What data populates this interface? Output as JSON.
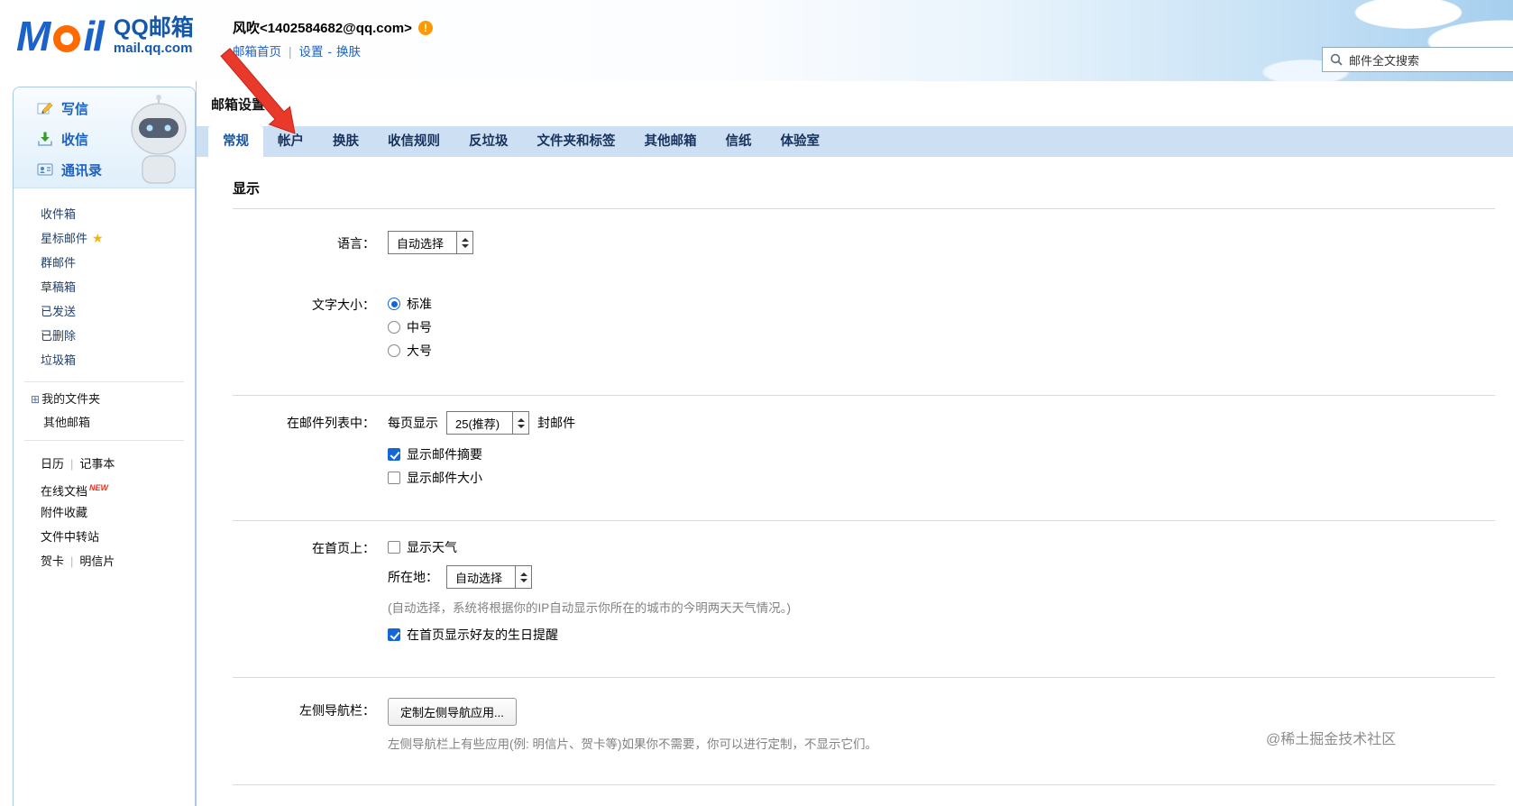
{
  "header": {
    "logo": {
      "m": "M",
      "il": "il",
      "product": "QQ邮箱",
      "domain": "mail.qq.com",
      "a_icon": "orange-ring-icon"
    },
    "user": {
      "name_email": "风吹<1402584682@qq.com>",
      "info_badge": "!",
      "info_icon": "info-warning-icon"
    },
    "nav": {
      "home": "邮箱首页",
      "sep": "|",
      "settings": "设置",
      "dash": "-",
      "skin": "换肤"
    },
    "search": {
      "placeholder": "邮件全文搜索",
      "icon": "search-icon"
    }
  },
  "sidebar": {
    "actions": [
      {
        "label": "写信",
        "icon": "compose-icon"
      },
      {
        "label": "收信",
        "icon": "receive-mail-icon"
      },
      {
        "label": "通讯录",
        "icon": "contacts-icon"
      }
    ],
    "folders": [
      {
        "label": "收件箱"
      },
      {
        "label": "星标邮件",
        "star_icon": "★"
      },
      {
        "label": "群邮件"
      },
      {
        "label": "草稿箱"
      },
      {
        "label": "已发送"
      },
      {
        "label": "已删除"
      },
      {
        "label": "垃圾箱"
      }
    ],
    "groups": {
      "my_folders": {
        "label": "我的文件夹",
        "expand_glyph": "⊞"
      },
      "other_mail": {
        "label": "其他邮箱"
      }
    },
    "tools": {
      "calendar": "日历",
      "notes": "记事本",
      "docs": "在线文档",
      "docs_badge": "NEW",
      "attachments": "附件收藏",
      "transfer": "文件中转站",
      "cards": "贺卡",
      "postcards": "明信片",
      "sep": "|"
    }
  },
  "main": {
    "title": "邮箱设置",
    "tabs": [
      {
        "label": "常规",
        "active": true
      },
      {
        "label": "帐户"
      },
      {
        "label": "换肤"
      },
      {
        "label": "收信规则"
      },
      {
        "label": "反垃圾"
      },
      {
        "label": "文件夹和标签"
      },
      {
        "label": "其他邮箱"
      },
      {
        "label": "信纸"
      },
      {
        "label": "体验室"
      }
    ],
    "section": {
      "title": "显示"
    },
    "language": {
      "label": "语言：",
      "value": "自动选择"
    },
    "text_size": {
      "label": "文字大小：",
      "options": [
        {
          "label": "标准",
          "selected": true
        },
        {
          "label": "中号",
          "selected": false
        },
        {
          "label": "大号",
          "selected": false
        }
      ]
    },
    "mail_list": {
      "label": "在邮件列表中：",
      "per_page_prefix": "每页显示",
      "per_page_value": "25(推荐)",
      "per_page_suffix": "封邮件",
      "show_summary": {
        "label": "显示邮件摘要",
        "checked": true
      },
      "show_size": {
        "label": "显示邮件大小",
        "checked": false
      }
    },
    "homepage": {
      "label": "在首页上：",
      "weather": {
        "label": "显示天气",
        "checked": false
      },
      "location_label": "所在地：",
      "location_value": "自动选择",
      "note": "(自动选择，系统将根据你的IP自动显示你所在的城市的今明两天天气情况。)",
      "birthday": {
        "label": "在首页显示好友的生日提醒",
        "checked": true
      }
    },
    "left_nav": {
      "label": "左侧导航栏：",
      "button": "定制左侧导航应用...",
      "note": "左侧导航栏上有些应用(例: 明信片、贺卡等)如果你不需要，你可以进行定制，不显示它们。"
    }
  },
  "annotation": {
    "arrow_color": "#e8392b"
  },
  "watermark": "@稀土掘金技术社区"
}
